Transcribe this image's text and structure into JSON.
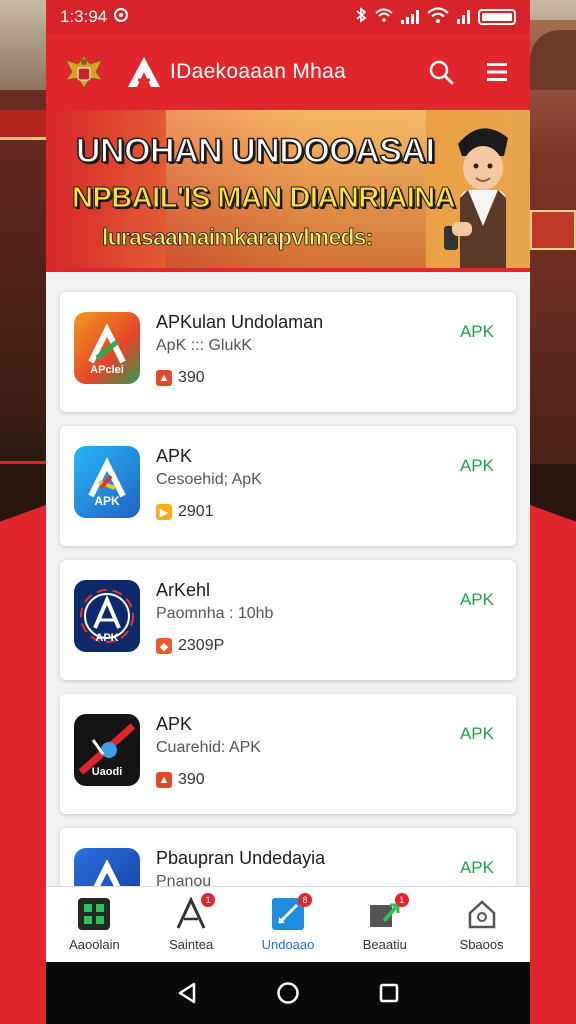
{
  "status_bar": {
    "time": "1:3:94",
    "colors": {
      "bar": "#d8232a"
    }
  },
  "header": {
    "title": "IDaekoaaan Mhaa",
    "emblem_icon": "garuda-emblem-icon",
    "logo_icon": "triangle-a-logo-icon",
    "search_icon": "search-icon",
    "menu_icon": "hamburger-menu-icon",
    "color": "#e1262d"
  },
  "banner": {
    "line1": "UNOHAN UNDOOASAI",
    "line2": "NPBAIL'IS MAN DIANRIAINA",
    "line3": "lurasaamaimkarapvlmeds:"
  },
  "apps": [
    {
      "title": "APKulan Undolaman",
      "subtitle": "ApK ::: GlukK",
      "meta": "390",
      "action": "APK",
      "icon": "colorful-a-app-icon",
      "icon_label": "APclei"
    },
    {
      "title": "APK",
      "subtitle": "Cesoehid; ApK",
      "meta": "2901",
      "action": "APK",
      "icon": "blue-a-app-icon",
      "icon_label": "APK"
    },
    {
      "title": "ArKehl",
      "subtitle": "Paomnha : 10hb",
      "meta": "2309P",
      "action": "APK",
      "icon": "navy-circle-a-app-icon",
      "icon_label": "APK"
    },
    {
      "title": "APK",
      "subtitle": "Cuarehid: APK",
      "meta": "390",
      "action": "APK",
      "icon": "black-slash-app-icon",
      "icon_label": "Uaodi"
    },
    {
      "title": "Pbaupran Undedayia",
      "subtitle": "Pnanou",
      "meta": "",
      "action": "APK",
      "icon": "blue-a-app-icon",
      "icon_label": ""
    }
  ],
  "bottom_nav": [
    {
      "label": "Aaoolain",
      "icon": "grid-home-icon",
      "badge": ""
    },
    {
      "label": "Saintea",
      "icon": "a-logo-icon",
      "badge": "1"
    },
    {
      "label": "Undoaao",
      "icon": "download-edit-icon",
      "badge": "8",
      "active": true
    },
    {
      "label": "Beaatiu",
      "icon": "upload-arrow-icon",
      "badge": "1"
    },
    {
      "label": "Sbaoos",
      "icon": "settings-house-icon",
      "badge": ""
    }
  ],
  "system_nav": {
    "back_icon": "back-triangle-icon",
    "home_icon": "home-circle-icon",
    "recents_icon": "recents-square-icon"
  },
  "accent_colors": {
    "red": "#e1262d",
    "green_action": "#22a34a",
    "active_blue": "#1f6fd6"
  }
}
